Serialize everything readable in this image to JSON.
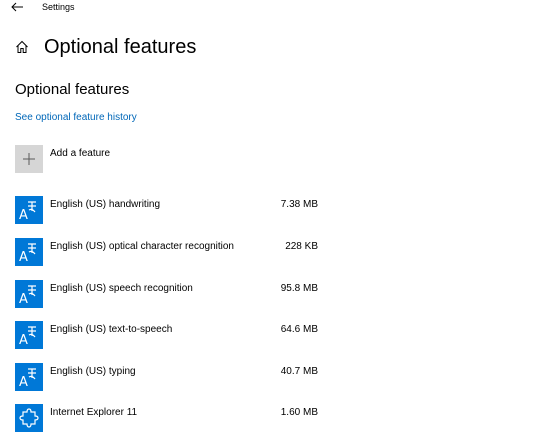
{
  "window": {
    "title": "Settings"
  },
  "header": {
    "title": "Optional features"
  },
  "section": {
    "title": "Optional features",
    "history_link": "See optional feature history"
  },
  "add_feature": {
    "label": "Add a feature"
  },
  "features": [
    {
      "name": "English (US) handwriting",
      "size": "7.38 MB",
      "icon": "language-icon"
    },
    {
      "name": "English (US) optical character recognition",
      "size": "228 KB",
      "icon": "language-icon"
    },
    {
      "name": "English (US) speech recognition",
      "size": "95.8 MB",
      "icon": "language-icon"
    },
    {
      "name": "English (US) text-to-speech",
      "size": "64.6 MB",
      "icon": "language-icon"
    },
    {
      "name": "English (US) typing",
      "size": "40.7 MB",
      "icon": "language-icon"
    },
    {
      "name": "Internet Explorer 11",
      "size": "1.60 MB",
      "icon": "puzzle-piece-icon"
    }
  ],
  "colors": {
    "accent": "#0078d7",
    "link": "#0067b8",
    "add_tile": "#d6d6d6"
  }
}
